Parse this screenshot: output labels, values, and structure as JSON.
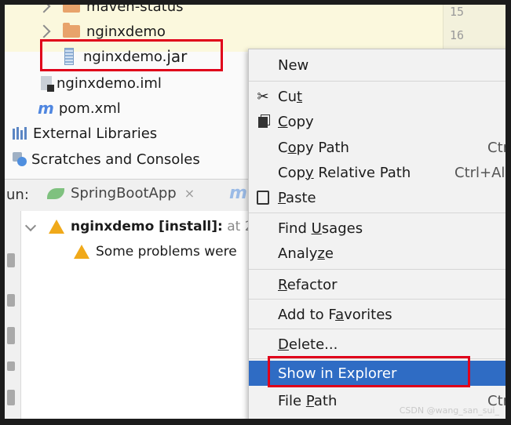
{
  "tree": {
    "cut_top_label": "maven-status",
    "items": [
      {
        "label": "nginxdemo"
      },
      {
        "label": "nginxdemo.",
        "suffix": "jar"
      },
      {
        "label": "nginxdemo.iml"
      },
      {
        "label": "pom.xml"
      },
      {
        "label": "External Libraries"
      },
      {
        "label": "Scratches and Consoles"
      }
    ]
  },
  "gutter": {
    "lines": [
      "15",
      "16"
    ]
  },
  "run": {
    "label": "un:",
    "tab_label": "SpringBootApp",
    "tab_close": "×",
    "tab2_label": "m",
    "output": {
      "title": "nginxdemo [install]:",
      "title_suffix": "at 2",
      "message": "Some problems were"
    }
  },
  "menu": {
    "items": [
      {
        "pre": "New",
        "u": "",
        "post": "",
        "shortcut": ""
      },
      {
        "pre": "Cu",
        "u": "t",
        "post": "",
        "shortcut": "",
        "icon": "scissors-icon"
      },
      {
        "pre": "",
        "u": "C",
        "post": "opy",
        "shortcut": "",
        "icon": "copy-icon"
      },
      {
        "pre": "C",
        "u": "o",
        "post": "py Path",
        "shortcut": "Ctr"
      },
      {
        "pre": "Cop",
        "u": "y",
        "post": " Relative Path",
        "shortcut": "Ctrl+Al"
      },
      {
        "pre": "",
        "u": "P",
        "post": "aste",
        "shortcut": "",
        "icon": "paste-icon"
      },
      {
        "pre": "Find ",
        "u": "U",
        "post": "sages",
        "shortcut": ""
      },
      {
        "pre": "Analy",
        "u": "z",
        "post": "e",
        "shortcut": ""
      },
      {
        "pre": "",
        "u": "R",
        "post": "efactor",
        "shortcut": ""
      },
      {
        "pre": "Add to F",
        "u": "a",
        "post": "vorites",
        "shortcut": ""
      },
      {
        "pre": "",
        "u": "D",
        "post": "elete...",
        "shortcut": ""
      },
      {
        "pre": "Show in Explorer",
        "u": "",
        "post": "",
        "shortcut": ""
      },
      {
        "pre": "File ",
        "u": "P",
        "post": "ath",
        "shortcut": "Ctrl"
      }
    ]
  },
  "watermark": "CSDN @wang_san_sui_",
  "colors": {
    "selection": "#2f6cc4",
    "highlight_box": "#e0001a",
    "warning": "#f0a91a"
  }
}
